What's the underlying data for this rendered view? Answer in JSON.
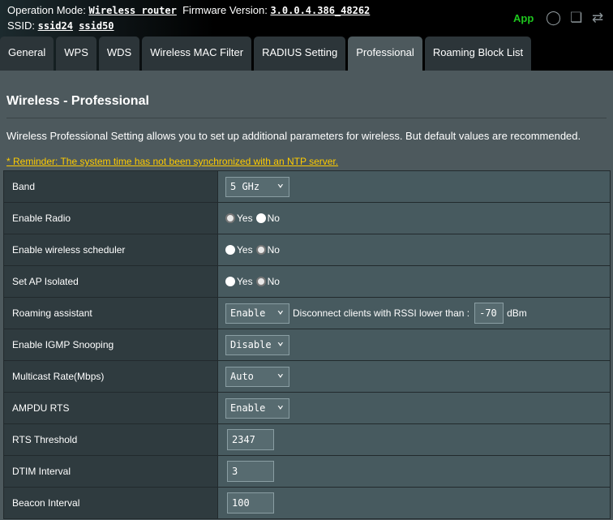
{
  "header": {
    "op_mode_label": "Operation Mode:",
    "op_mode": "Wireless router",
    "fw_label": "Firmware Version:",
    "fw": "3.0.0.4.386_48262",
    "ssid_label": "SSID:",
    "ssids": [
      "ssid24",
      "ssid50"
    ],
    "app": "App",
    "icons": [
      "users-icon",
      "devices-icon",
      "usb-icon"
    ]
  },
  "tabs": [
    "General",
    "WPS",
    "WDS",
    "Wireless MAC Filter",
    "RADIUS Setting",
    "Professional",
    "Roaming Block List"
  ],
  "active_tab": "Professional",
  "page": {
    "title": "Wireless - Professional",
    "description": "Wireless Professional Setting allows you to set up additional parameters for wireless. But default values are recommended.",
    "reminder": "* Reminder: The system time has not been synchronized with an NTP server."
  },
  "radio": {
    "yes": "Yes",
    "no": "No"
  },
  "rows": {
    "band": {
      "label": "Band",
      "value": "5 GHz"
    },
    "enable_radio": {
      "label": "Enable Radio",
      "selected": "Yes"
    },
    "scheduler": {
      "label": "Enable wireless scheduler",
      "selected": "No"
    },
    "ap_isolated": {
      "label": "Set AP Isolated",
      "selected": "No"
    },
    "roaming": {
      "label": "Roaming assistant",
      "value": "Enable",
      "text": "Disconnect clients with RSSI lower than :",
      "rssi": "-70",
      "unit": "dBm"
    },
    "igmp": {
      "label": "Enable IGMP Snooping",
      "value": "Disable"
    },
    "multicast": {
      "label": "Multicast Rate(Mbps)",
      "value": "Auto"
    },
    "ampdu": {
      "label": "AMPDU RTS",
      "value": "Enable"
    },
    "rts": {
      "label": "RTS Threshold",
      "value": "2347"
    },
    "dtim": {
      "label": "DTIM Interval",
      "value": "3"
    },
    "beacon": {
      "label": "Beacon Interval",
      "value": "100"
    }
  },
  "colors": {
    "app": "#1ec71e",
    "reminder": "#ffcc00",
    "content_bg": "#4d595d"
  }
}
